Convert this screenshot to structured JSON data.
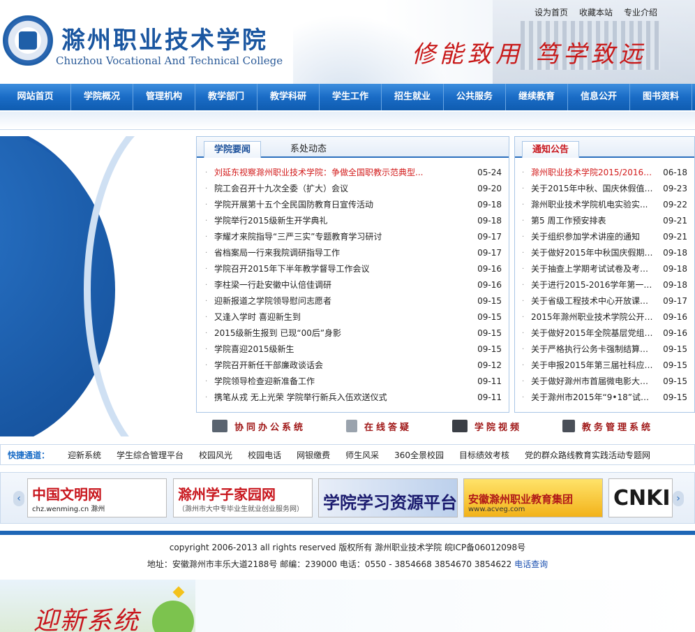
{
  "header": {
    "title_cn": "滁州职业技术学院",
    "title_en": "Chuzhou Vocational And Technical College",
    "motto": "修能致用 笃学致远",
    "top_links": [
      "设为首页",
      "收藏本站",
      "专业介绍"
    ]
  },
  "nav": [
    "网站首页",
    "学院概况",
    "管理机构",
    "教学部门",
    "教学科研",
    "学生工作",
    "招生就业",
    "公共服务",
    "继续教育",
    "信息公开",
    "图书资料"
  ],
  "news": {
    "tabs": [
      "学院要闻",
      "系处动态"
    ],
    "items": [
      {
        "title": "刘延东视察滁州职业技术学院：争做全国职教示范典型...",
        "date": "05-24"
      },
      {
        "title": "院工会召开十九次全委（扩大）会议",
        "date": "09-20"
      },
      {
        "title": "学院开展第十五个全民国防教育日宣传活动",
        "date": "09-18"
      },
      {
        "title": "学院举行2015级新生开学典礼",
        "date": "09-18"
      },
      {
        "title": "李耀才来院指导“三严三实”专题教育学习研讨",
        "date": "09-17"
      },
      {
        "title": "省档案局一行来我院调研指导工作",
        "date": "09-17"
      },
      {
        "title": "学院召开2015年下半年教学督导工作会议",
        "date": "09-16"
      },
      {
        "title": "李柱梁一行赴安徽中认倍佳调研",
        "date": "09-16"
      },
      {
        "title": "迎新报道之学院领导慰问志愿者",
        "date": "09-15"
      },
      {
        "title": "又逢入学时 喜迎新生到",
        "date": "09-15"
      },
      {
        "title": "2015级新生报到 已现“00后”身影",
        "date": "09-15"
      },
      {
        "title": "学院喜迎2015级新生",
        "date": "09-15"
      },
      {
        "title": "学院召开新任干部廉政谈话会",
        "date": "09-12"
      },
      {
        "title": "学院领导检查迎新准备工作",
        "date": "09-11"
      },
      {
        "title": "携笔从戎 无上光荣 学院举行新兵入伍欢送仪式",
        "date": "09-11"
      }
    ]
  },
  "notice": {
    "tab": "通知公告",
    "items": [
      {
        "title": "滁州职业技术学院2015/2016学...",
        "date": "06-18"
      },
      {
        "title": "关于2015年中秋、国庆休假值班...",
        "date": "09-23"
      },
      {
        "title": "滁州职业技术学院机电实验实...",
        "date": "09-22"
      },
      {
        "title": "第5 周工作预安排表",
        "date": "09-21"
      },
      {
        "title": "关于组织参加学术讲座的通知",
        "date": "09-21"
      },
      {
        "title": "关于做好2015年中秋国庆假期间贯...",
        "date": "09-18"
      },
      {
        "title": "关于抽查上学期考试试卷及考核...",
        "date": "09-18"
      },
      {
        "title": "关于进行2015-2016学年第一学...",
        "date": "09-18"
      },
      {
        "title": "关于省级工程技术中心开放课题...",
        "date": "09-17"
      },
      {
        "title": "2015年滁州职业技术学院公开招...",
        "date": "09-16"
      },
      {
        "title": "关于做好2015年全院基层党组织...",
        "date": "09-16"
      },
      {
        "title": "关于严格执行公务卡强制结算目...",
        "date": "09-15"
      },
      {
        "title": "关于申报2015年第三届社科应用...",
        "date": "09-15"
      },
      {
        "title": "关于做好滁州市首届微电影大赛...",
        "date": "09-15"
      },
      {
        "title": "关于滁州市2015年“9•18”试鸣...",
        "date": "09-15"
      }
    ]
  },
  "systems": [
    {
      "label": "协同办公系统",
      "icon": "monitor-icon",
      "color": "#5a6470"
    },
    {
      "label": "在线答疑",
      "icon": "document-icon",
      "color": "#9aa3ad"
    },
    {
      "label": "学院视频",
      "icon": "film-icon",
      "color": "#3b3f46"
    },
    {
      "label": "教务管理系统",
      "icon": "books-icon",
      "color": "#4a4f58"
    }
  ],
  "quick": {
    "label": "快捷通道：",
    "links": [
      "迎新系统",
      "学生综合管理平台",
      "校园风光",
      "校园电话",
      "网银缴费",
      "师生风采",
      "360全景校园",
      "目标绩效考核",
      "党的群众路线教育实践活动专题网"
    ]
  },
  "link_banners": [
    {
      "main": "中国文明网",
      "sub": "chz.wenming.cn  滁州",
      "color": "#c8161d"
    },
    {
      "main": "滁州学子家园网",
      "sub": "（滁州市大中专毕业生就业创业服务网）",
      "color": "#c8161d"
    },
    {
      "main": "学院学习资源平台",
      "sub": "",
      "color": "#1a1a6e"
    },
    {
      "main": "安徽滁州职业教育集团",
      "sub": "www.acveg.com",
      "color": "#b01818"
    },
    {
      "main": "CNKI",
      "sub": "",
      "color": "#1a1a1a"
    }
  ],
  "footer": {
    "copyright": "copyright 2006-2013 all rights reserved 版权所有 滁州职业技术学院 皖ICP备06012098号",
    "address": "地址：安徽滁州市丰乐大道2188号 邮编：239000 电话：0550 - 3854668 3854670 3854622 ",
    "tel_link": "电话查询"
  },
  "welcome_banner": "迎新系统",
  "colors": {
    "brand_blue": "#1a6cc6",
    "accent_red": "#c8161d"
  }
}
